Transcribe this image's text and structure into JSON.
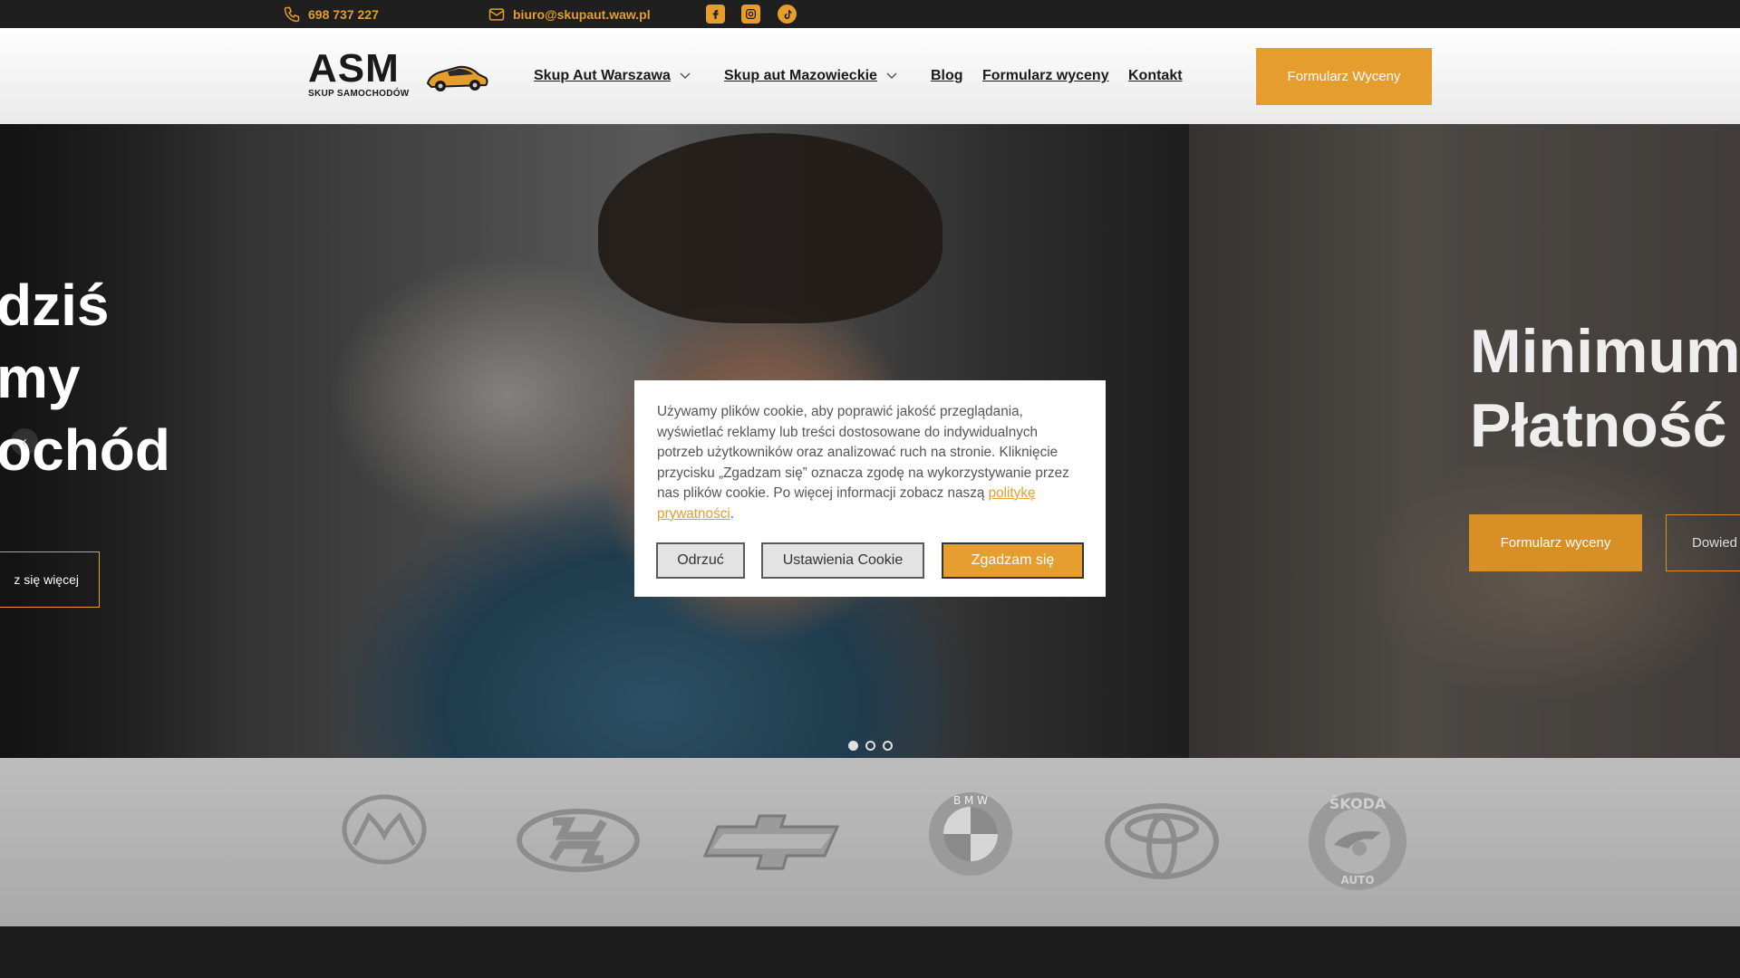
{
  "topbar": {
    "phone": "698 737 227",
    "email": "biuro@skupaut.waw.pl",
    "socials": [
      "facebook-icon",
      "instagram-icon",
      "tiktok-icon"
    ],
    "accent_color": "#e59d2e"
  },
  "header": {
    "logo_text": "ASM",
    "logo_subtext": "SKUP SAMOCHODÓW",
    "nav": [
      {
        "label": "Skup Aut Warszawa",
        "dropdown": true
      },
      {
        "label": "Skup aut Mazowieckie",
        "dropdown": true
      },
      {
        "label": "Blog",
        "dropdown": false
      },
      {
        "label": "Formularz wyceny",
        "dropdown": false
      },
      {
        "label": "Kontakt",
        "dropdown": false
      }
    ],
    "cta_label": "Formularz Wyceny"
  },
  "hero": {
    "left_heading_lines": [
      "dziś",
      "my",
      "ochód"
    ],
    "left_button": "z się więcej",
    "right_heading_lines": [
      "Minimum",
      "Płatność"
    ],
    "right_button_primary": "Formularz wyceny",
    "right_button_secondary": "Dowied",
    "slides_total": 3,
    "active_slide": 1
  },
  "brands": [
    "mazda-logo",
    "hyundai-logo",
    "chevrolet-logo",
    "bmw-logo",
    "toyota-logo",
    "skoda-logo"
  ],
  "cookie": {
    "text_before_link": "Używamy plików cookie, aby poprawić jakość przeglądania, wyświetlać reklamy lub treści dostosowane do indywidualnych potrzeb użytkowników oraz analizować ruch na stronie. Kliknięcie przycisku „Zgadzam się” oznacza zgodę na wykorzystywanie przez nas plików cookie. Po więcej informacji zobacz naszą ",
    "link_text": "politykę prywatności",
    "text_after_link": ".",
    "reject_label": "Odrzuć",
    "settings_label": "Ustawienia Cookie",
    "accept_label": "Zgadzam się"
  }
}
